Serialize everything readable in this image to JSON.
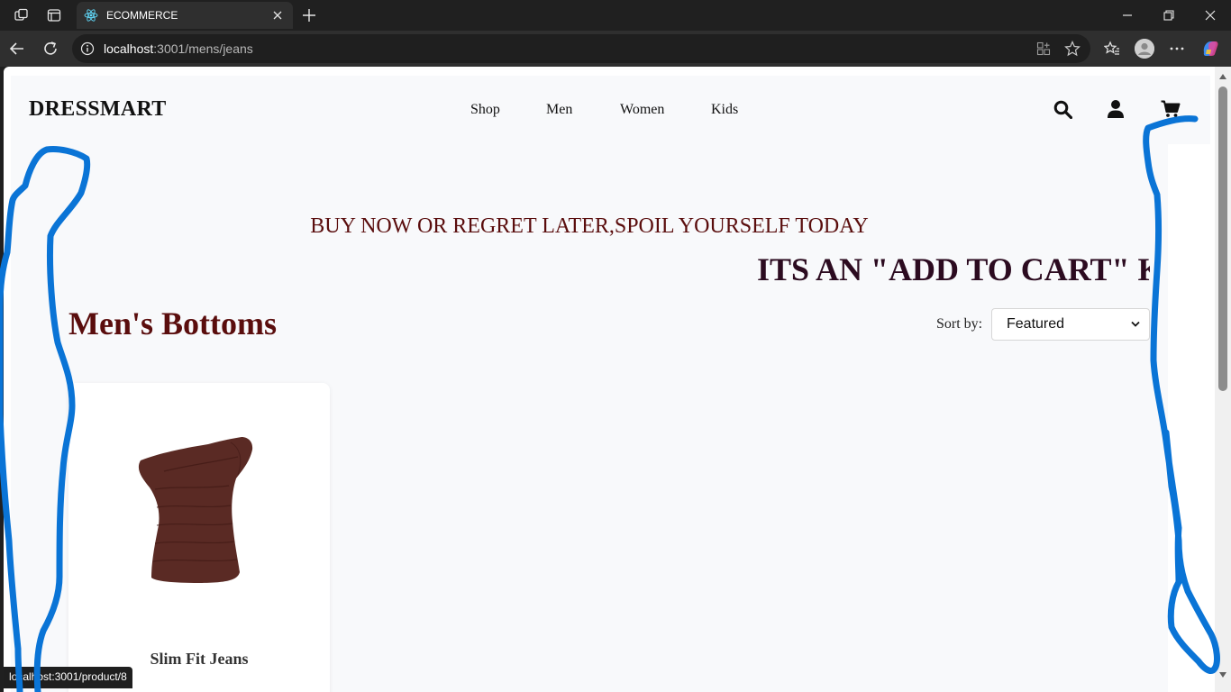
{
  "browser": {
    "tab_title": "ECOMMERCE",
    "url_host": "localhost",
    "url_path": ":3001/mens/jeans",
    "status_url": "localhost:3001/product/8"
  },
  "site": {
    "logo": "DRESSMART",
    "nav": [
      "Shop",
      "Men",
      "Women",
      "Kids"
    ],
    "promo_line1": "BUY NOW OR REGRET LATER,SPOIL YOURSELF TODAY",
    "promo_line2": "ITS AN \"ADD TO CART\" K",
    "page_title": "Men's Bottoms",
    "sort_label": "Sort by:",
    "sort_value": "Featured"
  },
  "products": [
    {
      "name": "Slim Fit Jeans",
      "image": "brown-asymmetric-top"
    }
  ],
  "colors": {
    "accent_dark_red": "#5a0d0d",
    "promo_purple": "#2c0b20",
    "annotation_blue": "#0a74d6"
  },
  "icons": {
    "header": [
      "search-icon",
      "user-icon",
      "cart-icon"
    ]
  }
}
